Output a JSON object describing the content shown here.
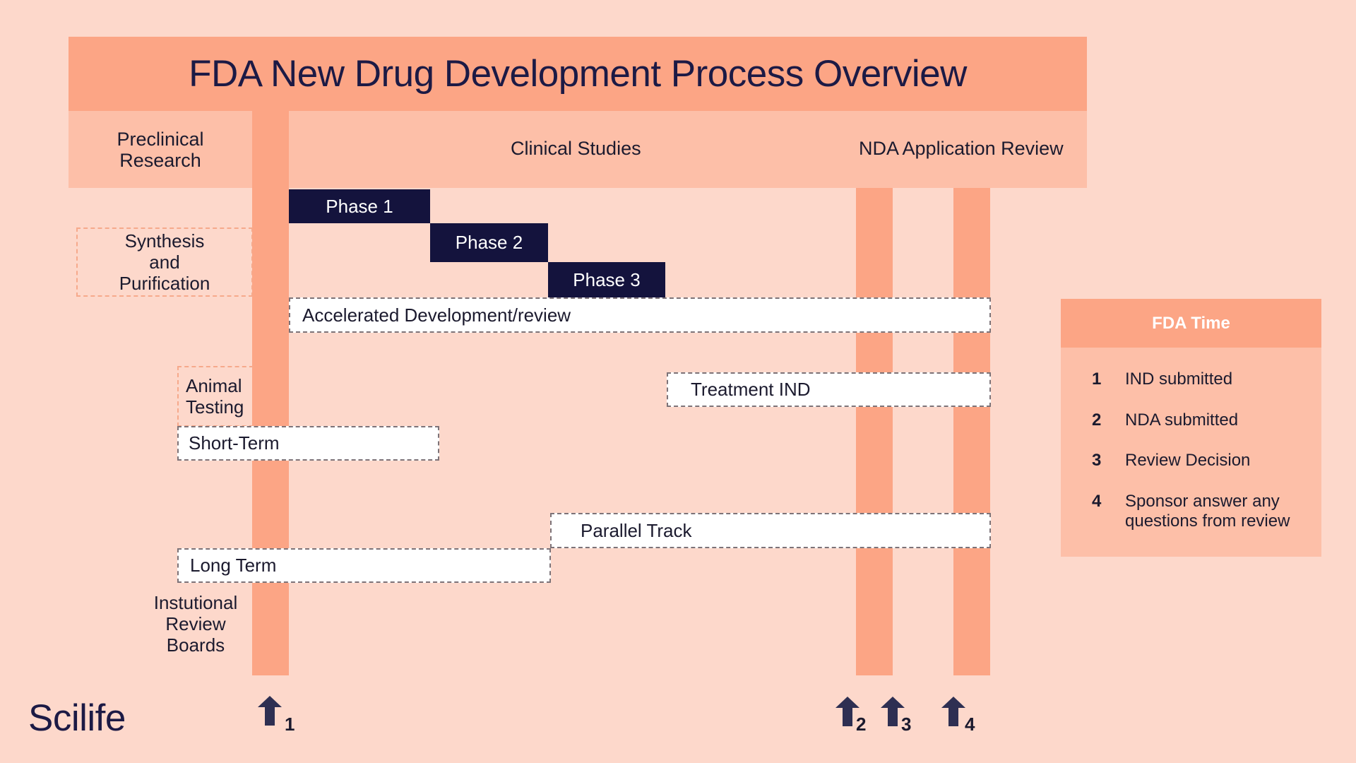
{
  "title": "FDA New Drug Development Process Overview",
  "stages": {
    "preclinical": "Preclinical Research",
    "clinical": "Clinical Studies",
    "nda": "NDA Application Review"
  },
  "phases": [
    "Phase 1",
    "Phase 2",
    "Phase 3"
  ],
  "preclinical_items": {
    "synthesis": "Synthesis and Purification",
    "animal": "Animal Testing",
    "irb": "Instutional Review Boards"
  },
  "tracks": {
    "accelerated": "Accelerated Development/review",
    "treatment_ind": "Treatment IND",
    "short_term": "Short-Term",
    "parallel": "Parallel Track",
    "long_term": "Long Term"
  },
  "milestones": [
    "1",
    "2",
    "3",
    "4"
  ],
  "legend": {
    "title": "FDA Time",
    "items": [
      {
        "num": "1",
        "label": "IND submitted"
      },
      {
        "num": "2",
        "label": "NDA submitted"
      },
      {
        "num": "3",
        "label": "Review Decision"
      },
      {
        "num": "4",
        "label": "Sponsor answer any questions from review"
      }
    ]
  },
  "brand": "Scilife",
  "colors": {
    "background": "#fdd8cb",
    "header": "#fca585",
    "subheader": "#fdbfa8",
    "phase": "#14133d",
    "text": "#1b1a2e",
    "arrow": "#2e2f52"
  }
}
